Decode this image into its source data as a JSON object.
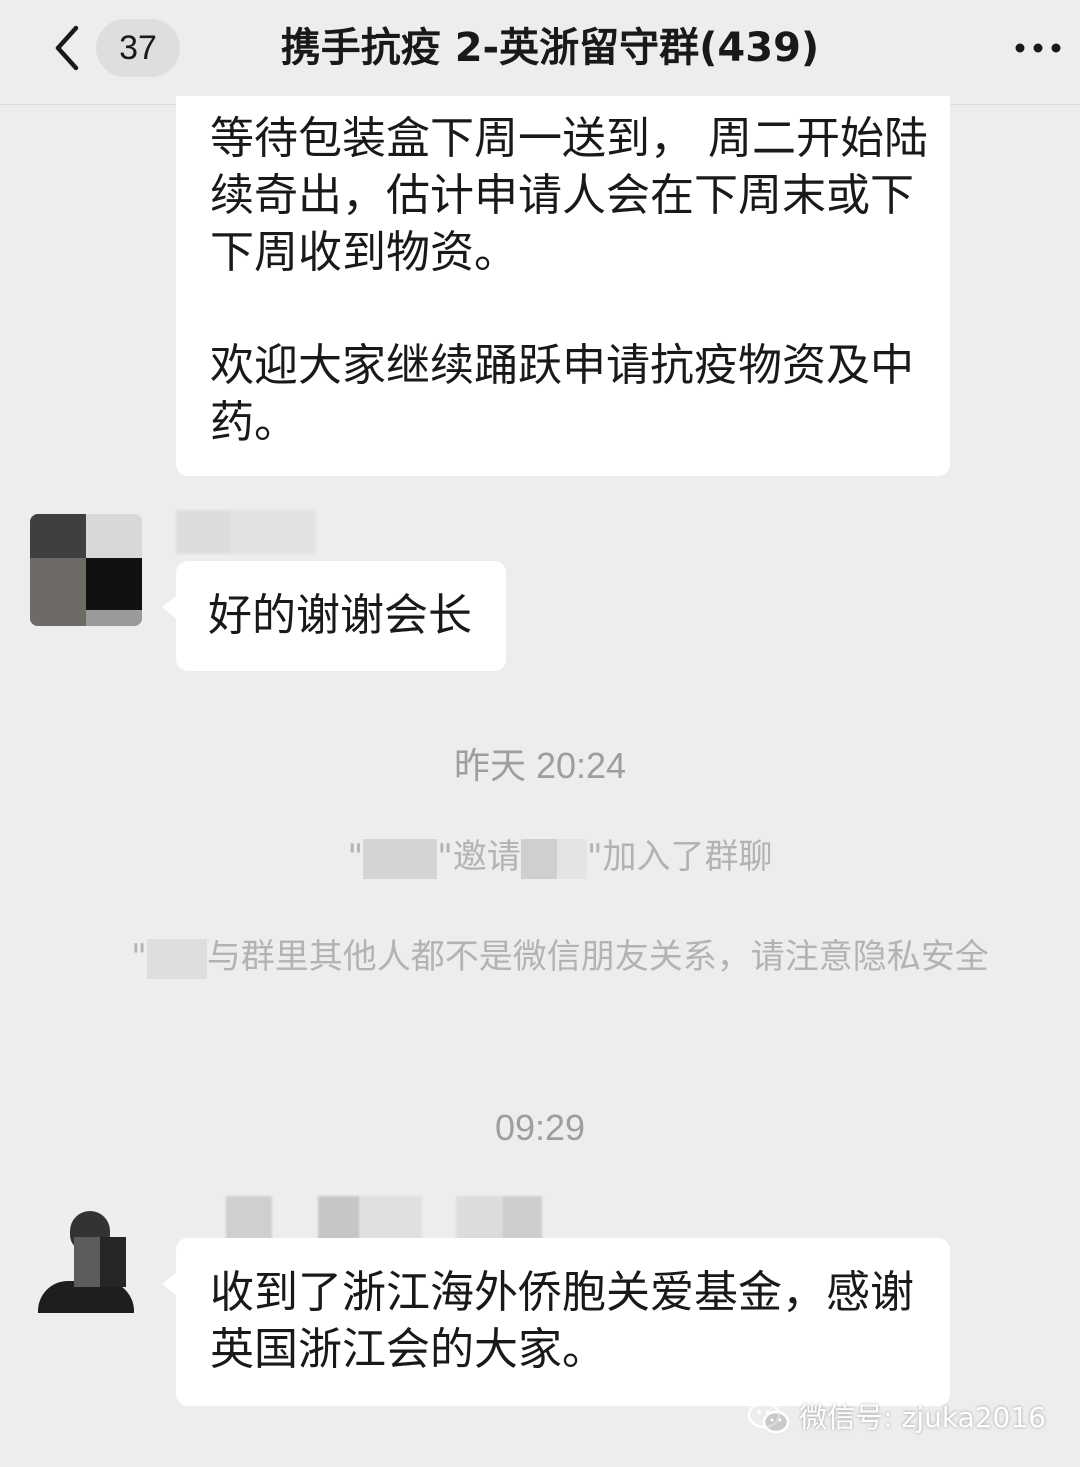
{
  "header": {
    "unread_count": "37",
    "title": "携手抗疫 2-英浙留守群(439)"
  },
  "messages": {
    "first": {
      "para1": "等待包装盒下周一送到， 周二开始陆续奇出，估计申请人会在下周末或下下周收到物资。",
      "para2": "欢迎大家继续踊跃申请抗疫物资及中药。"
    },
    "second": {
      "text": "好的谢谢会长"
    },
    "timestamp1": "昨天 20:24",
    "system_invite": {
      "q1": "\"",
      "q2": "\"邀请",
      "q3": "\"加入了群聊"
    },
    "system_notice": {
      "prefix": "\"",
      "text": "与群里其他人都不是微信朋友关系，请注意隐私安全"
    },
    "timestamp2": "09:29",
    "third": {
      "text": "收到了浙江海外侨胞关爱基金，感谢英国浙江会的大家。"
    }
  },
  "watermark": {
    "text": "微信号: zjuka2016"
  },
  "colors": {
    "background": "#ededed",
    "bubble": "#ffffff",
    "timestamp": "#9e9e9e",
    "system_text": "#b3b3b3"
  }
}
